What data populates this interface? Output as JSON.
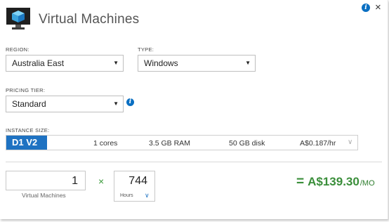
{
  "header": {
    "title": "Virtual Machines",
    "close_glyph": "×",
    "info_glyph": "i"
  },
  "region": {
    "label": "REGION:",
    "value": "Australia East"
  },
  "type": {
    "label": "TYPE:",
    "value": "Windows"
  },
  "pricing_tier": {
    "label": "PRICING TIER:",
    "value": "Standard",
    "info_glyph": "i"
  },
  "instance": {
    "label": "INSTANCE SIZE:",
    "name": "D1 V2",
    "cores": "1 cores",
    "ram": "3.5 GB RAM",
    "disk": "50 GB disk",
    "price": "A$0.187/hr"
  },
  "calc": {
    "vm_count": "1",
    "vm_label": "Virtual Machines",
    "times": "×",
    "hours": "744",
    "hours_label": "Hours",
    "equals": "=",
    "total": "A$139.30",
    "total_unit": "/MO"
  },
  "colors": {
    "accent": "#1e72c2",
    "total_green": "#3a8e3a"
  },
  "icons": [
    "virtual-machine-logo-icon",
    "info-icon",
    "close-icon",
    "dropdown-arrow-icon",
    "chevron-down-icon"
  ]
}
